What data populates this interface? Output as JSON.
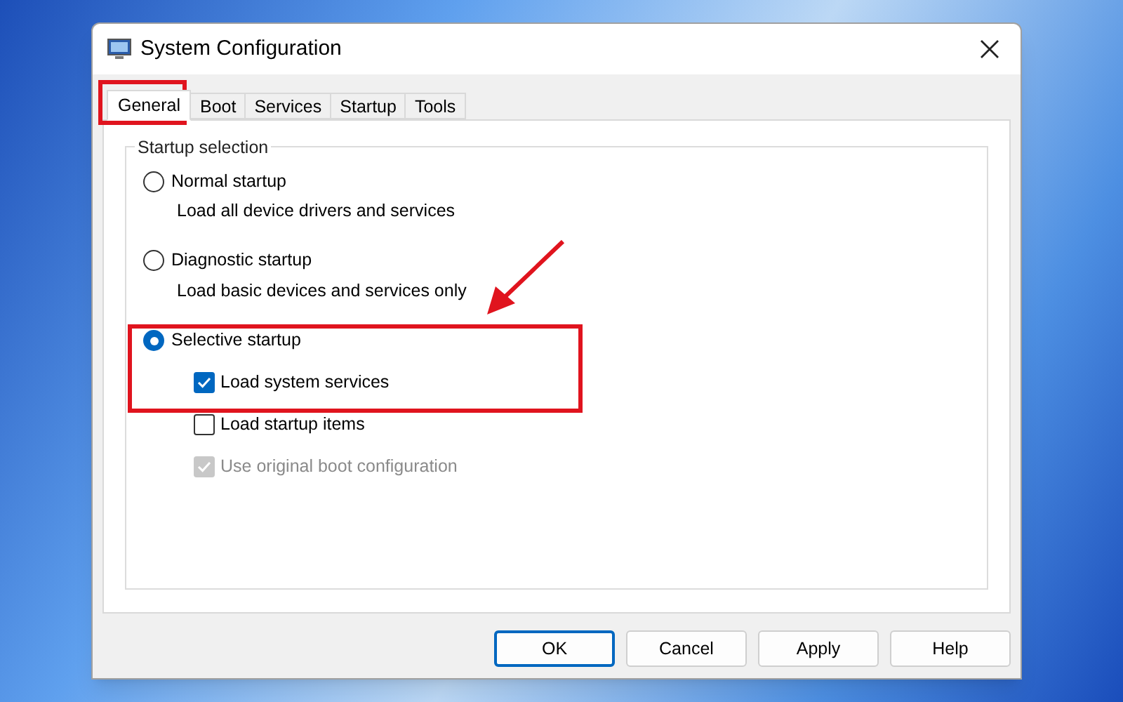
{
  "window": {
    "title": "System Configuration"
  },
  "tabs": [
    {
      "label": "General",
      "selected": true
    },
    {
      "label": "Boot",
      "selected": false
    },
    {
      "label": "Services",
      "selected": false
    },
    {
      "label": "Startup",
      "selected": false
    },
    {
      "label": "Tools",
      "selected": false
    }
  ],
  "group": {
    "title": "Startup selection",
    "options": [
      {
        "label": "Normal startup",
        "selected": false,
        "description": "Load all device drivers and services"
      },
      {
        "label": "Diagnostic startup",
        "selected": false,
        "description": "Load basic devices and services only"
      },
      {
        "label": "Selective startup",
        "selected": true,
        "checkboxes": [
          {
            "label": "Load system services",
            "checked": true,
            "disabled": false
          },
          {
            "label": "Load startup items",
            "checked": false,
            "disabled": false
          },
          {
            "label": "Use original boot configuration",
            "checked": true,
            "disabled": true
          }
        ]
      }
    ]
  },
  "buttons": [
    {
      "label": "OK",
      "kind": "default"
    },
    {
      "label": "Cancel",
      "kind": "normal"
    },
    {
      "label": "Apply",
      "kind": "normal"
    },
    {
      "label": "Help",
      "kind": "normal"
    }
  ]
}
